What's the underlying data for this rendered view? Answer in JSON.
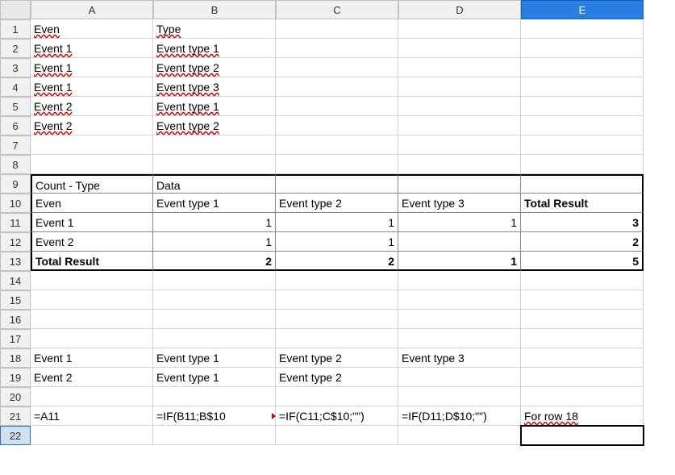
{
  "columns": [
    "A",
    "B",
    "C",
    "D",
    "E"
  ],
  "rows": [
    "1",
    "2",
    "3",
    "4",
    "5",
    "6",
    "7",
    "8",
    "9",
    "10",
    "11",
    "12",
    "13",
    "14",
    "15",
    "16",
    "17",
    "18",
    "19",
    "20",
    "21",
    "22"
  ],
  "active_col": "E",
  "active_row": "22",
  "cells": {
    "A1": {
      "t": "Even",
      "wavy": true
    },
    "B1": {
      "t": "Type",
      "wavy": true
    },
    "A2": {
      "t": "Event 1",
      "wavy": true
    },
    "B2": {
      "t": "Event type 1",
      "wavy": true
    },
    "A3": {
      "t": "Event 1",
      "wavy": true
    },
    "B3": {
      "t": "Event type 2",
      "wavy": true
    },
    "A4": {
      "t": "Event 1",
      "wavy": true
    },
    "B4": {
      "t": "Event type 3",
      "wavy": true
    },
    "A5": {
      "t": "Event 2",
      "wavy": true
    },
    "B5": {
      "t": "Event type 1",
      "wavy": true
    },
    "A6": {
      "t": "Event 2",
      "wavy": true
    },
    "B6": {
      "t": "Event type 2",
      "wavy": true
    },
    "A9": {
      "t": "Count - Type"
    },
    "B9": {
      "t": "Data"
    },
    "A10": {
      "t": "Even"
    },
    "B10": {
      "t": "Event type 1"
    },
    "C10": {
      "t": "Event type 2"
    },
    "D10": {
      "t": "Event type 3"
    },
    "E10": {
      "t": "Total Result",
      "bold": true
    },
    "A11": {
      "t": "Event 1"
    },
    "B11": {
      "t": "1",
      "r": true
    },
    "C11": {
      "t": "1",
      "r": true
    },
    "D11": {
      "t": "1",
      "r": true
    },
    "E11": {
      "t": "3",
      "r": true,
      "bold": true
    },
    "A12": {
      "t": "Event 2"
    },
    "B12": {
      "t": "1",
      "r": true
    },
    "C12": {
      "t": "1",
      "r": true
    },
    "D12": {
      "t": ""
    },
    "E12": {
      "t": "2",
      "r": true,
      "bold": true
    },
    "A13": {
      "t": "Total Result",
      "bold": true
    },
    "B13": {
      "t": "2",
      "r": true,
      "bold": true
    },
    "C13": {
      "t": "2",
      "r": true,
      "bold": true
    },
    "D13": {
      "t": "1",
      "r": true,
      "bold": true
    },
    "E13": {
      "t": "5",
      "r": true,
      "bold": true
    },
    "A18": {
      "t": "Event 1"
    },
    "B18": {
      "t": "Event type 1"
    },
    "C18": {
      "t": "Event type 2"
    },
    "D18": {
      "t": "Event type 3"
    },
    "A19": {
      "t": "Event 2"
    },
    "B19": {
      "t": "Event type 1"
    },
    "C19": {
      "t": "Event type 2"
    },
    "A21": {
      "t": "=A11"
    },
    "B21": {
      "t": "=IF(B11;B$10",
      "overflow": true
    },
    "C21": {
      "t": "=IF(C11;C$10;\"\")"
    },
    "D21": {
      "t": "=IF(D11;D$10;\"\")"
    },
    "E21": {
      "t": "For row 18",
      "wavy": true
    }
  },
  "pivot": {
    "r0": 9,
    "r1": 13,
    "c0": "A",
    "c1": "E"
  },
  "cursor": "E22"
}
